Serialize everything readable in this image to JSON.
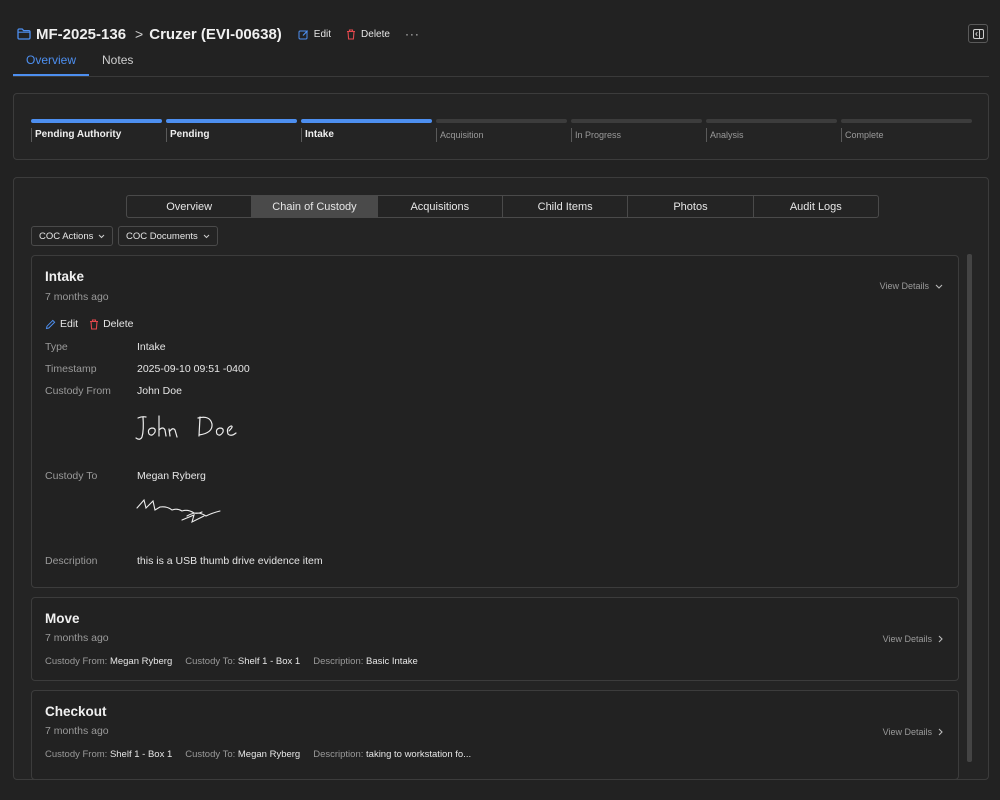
{
  "header": {
    "case_id": "MF-2025-136",
    "separator": ">",
    "item_name": "Cruzer (EVI-00638)",
    "edit_label": "Edit",
    "delete_label": "Delete",
    "more_label": "···"
  },
  "top_tabs": [
    {
      "label": "Overview",
      "active": true
    },
    {
      "label": "Notes",
      "active": false
    }
  ],
  "workflow": {
    "stages": [
      {
        "label": "Pending Authority",
        "done": true
      },
      {
        "label": "Pending",
        "done": true
      },
      {
        "label": "Intake",
        "done": true
      },
      {
        "label": "Acquisition",
        "done": false
      },
      {
        "label": "In Progress",
        "done": false
      },
      {
        "label": "Analysis",
        "done": false
      },
      {
        "label": "Complete",
        "done": false
      }
    ]
  },
  "subtabs": [
    {
      "label": "Overview",
      "active": false
    },
    {
      "label": "Chain of Custody",
      "active": true
    },
    {
      "label": "Acquisitions",
      "active": false
    },
    {
      "label": "Child Items",
      "active": false
    },
    {
      "label": "Photos",
      "active": false
    },
    {
      "label": "Audit Logs",
      "active": false
    }
  ],
  "coc_actions_label": "COC Actions",
  "coc_documents_label": "COC Documents",
  "entries": {
    "intake": {
      "title": "Intake",
      "time": "7 months ago",
      "view_details": "View Details",
      "edit_label": "Edit",
      "delete_label": "Delete",
      "type_label": "Type",
      "type_value": "Intake",
      "timestamp_label": "Timestamp",
      "timestamp_value": "2025-09-10 09:51 -0400",
      "from_label": "Custody From",
      "from_value": "John Doe",
      "to_label": "Custody To",
      "to_value": "Megan Ryberg",
      "description_label": "Description",
      "description_value": "this is a USB thumb drive evidence item",
      "from_signature_text": "John Doe"
    },
    "move": {
      "title": "Move",
      "time": "7 months ago",
      "view_details": "View Details",
      "from_label": "Custody From:",
      "from_value": "Megan Ryberg",
      "to_label": "Custody To:",
      "to_value": "Shelf 1 - Box 1",
      "description_label": "Description:",
      "description_value": "Basic Intake"
    },
    "checkout": {
      "title": "Checkout",
      "time": "7 months ago",
      "view_details": "View Details",
      "from_label": "Custody From:",
      "from_value": "Shelf 1 - Box 1",
      "to_label": "Custody To:",
      "to_value": "Megan Ryberg",
      "description_label": "Description:",
      "description_value": "taking to workstation fo..."
    }
  },
  "colors": {
    "background": "#222222",
    "accent": "#4d8ff0",
    "delete": "#e5484d",
    "border": "#3c3c3c"
  }
}
